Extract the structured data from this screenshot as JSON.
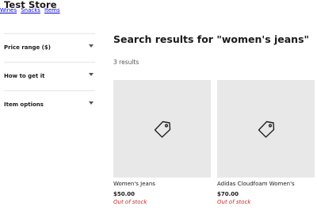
{
  "store": {
    "name": "Test Store"
  },
  "nav": {
    "links": [
      "Wines",
      "Snacks",
      "Items"
    ]
  },
  "filters": [
    {
      "label": "Price range ($)"
    },
    {
      "label": "How to get it"
    },
    {
      "label": "Item options"
    }
  ],
  "search": {
    "title": "Search results for \"women's jeans\"",
    "count": "3 results"
  },
  "products": [
    {
      "name": "Women's Jeans",
      "price": "$50.00",
      "stock": "Out of stock",
      "icon": "tag-icon"
    },
    {
      "name": "Adidas Cloudfoam Women's",
      "price": "$70.00",
      "stock": "Out of stock",
      "icon": "tag-icon"
    }
  ],
  "colors": {
    "placeholder_bg": "#e8e8e8",
    "out_of_stock": "#c62828"
  }
}
